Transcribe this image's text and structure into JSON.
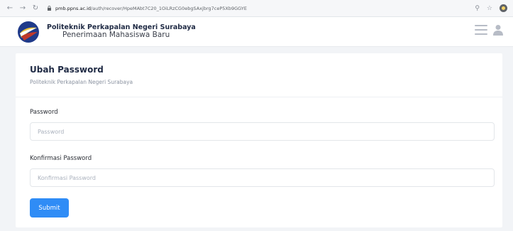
{
  "browser": {
    "url_host": "pmb.ppns.ac.id",
    "url_path": "/auth/recover/HpeMAbt7C20_1OiLRzCG0ebgSAxjbrg7ceP5Xb9GGYE"
  },
  "header": {
    "title_line1": "Politeknik Perkapalan Negeri Surabaya",
    "title_line2": "Penerimaan Mahasiswa Baru"
  },
  "card": {
    "title": "Ubah Password",
    "subtitle": "Politeknik Perkapalan Negeri Surabaya"
  },
  "form": {
    "password_label": "Password",
    "password_placeholder": "Password",
    "confirm_label": "Konfirmasi Password",
    "confirm_placeholder": "Konfirmasi Password",
    "submit_label": "Submit"
  },
  "colors": {
    "accent": "#2f8cf6",
    "page_bg": "#f2f4f7"
  }
}
